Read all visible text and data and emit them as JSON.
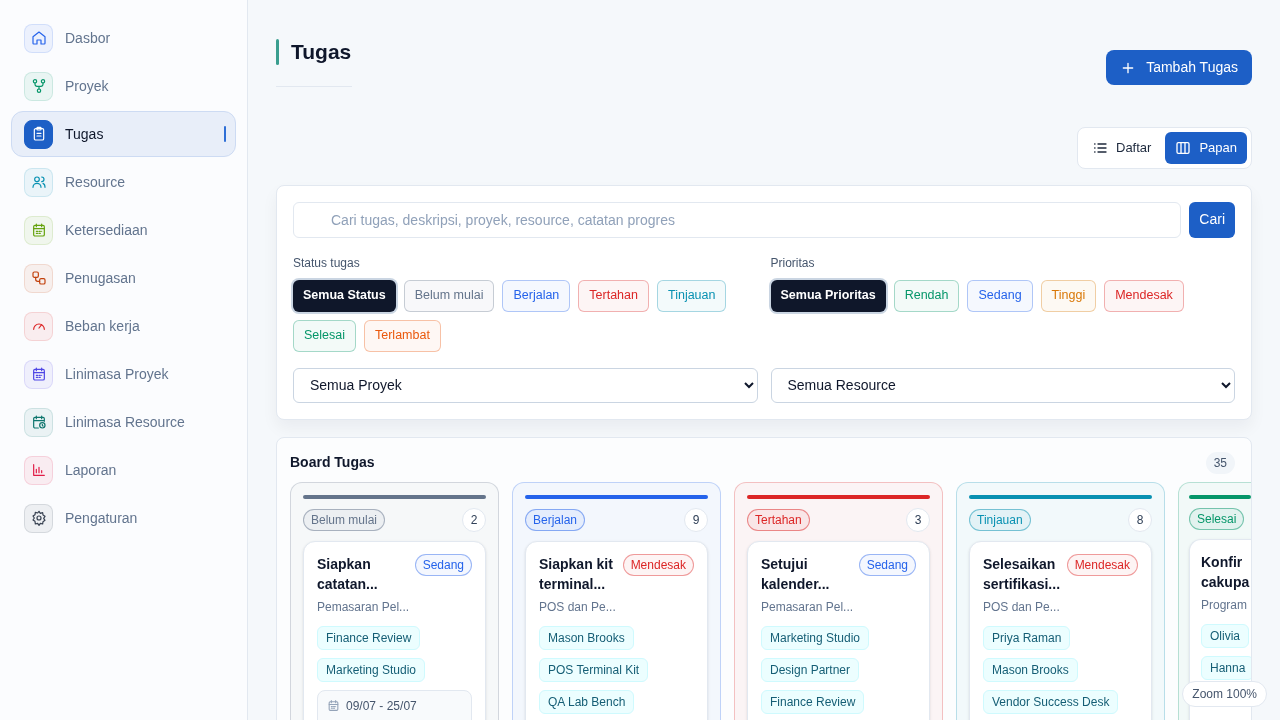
{
  "sidebar": {
    "items": [
      {
        "label": "Dasbor",
        "selected": false
      },
      {
        "label": "Proyek",
        "selected": false
      },
      {
        "label": "Tugas",
        "selected": true
      },
      {
        "label": "Resource",
        "selected": false
      },
      {
        "label": "Ketersediaan",
        "selected": false
      },
      {
        "label": "Penugasan",
        "selected": false
      },
      {
        "label": "Beban kerja",
        "selected": false
      },
      {
        "label": "Linimasa Proyek",
        "selected": false
      },
      {
        "label": "Linimasa Resource",
        "selected": false
      },
      {
        "label": "Laporan",
        "selected": false
      },
      {
        "label": "Pengaturan",
        "selected": false
      }
    ]
  },
  "header": {
    "title": "Tugas",
    "add_button": "Tambah Tugas"
  },
  "view_toggle": [
    {
      "label": "Daftar",
      "selected": false
    },
    {
      "label": "Papan",
      "selected": true
    }
  ],
  "filters": {
    "search": {
      "placeholder": "Cari tugas, deskripsi, proyek, resource, catatan progres"
    },
    "search_button": "Cari",
    "status": {
      "label": "Status tugas",
      "chips": [
        {
          "label": "Semua Status",
          "color": "#0f172a",
          "selected": true
        },
        {
          "label": "Belum mulai",
          "color": "#64748b",
          "selected": false
        },
        {
          "label": "Berjalan",
          "color": "#2563eb",
          "selected": false
        },
        {
          "label": "Tertahan",
          "color": "#dc2626",
          "selected": false
        },
        {
          "label": "Tinjauan",
          "color": "#0891b2",
          "selected": false
        },
        {
          "label": "Selesai",
          "color": "#059669",
          "selected": false
        },
        {
          "label": "Terlambat",
          "color": "#ea580c",
          "selected": false
        }
      ]
    },
    "priority": {
      "label": "Prioritas",
      "chips": [
        {
          "label": "Semua Prioritas",
          "color": "#0f172a",
          "selected": true
        },
        {
          "label": "Rendah",
          "color": "#059669",
          "selected": false
        },
        {
          "label": "Sedang",
          "color": "#2563eb",
          "selected": false
        },
        {
          "label": "Tinggi",
          "color": "#d97706",
          "selected": false
        },
        {
          "label": "Mendesak",
          "color": "#dc2626",
          "selected": false
        }
      ]
    },
    "selects": [
      "Semua Proyek",
      "Semua Resource"
    ]
  },
  "board": {
    "title": "Board Tugas",
    "count": "35",
    "columns": [
      {
        "status": "Belum mulai",
        "count": "2",
        "color": "#64748b",
        "cards": [
          {
            "title_lines": [
              "Siapkan",
              "catatan..."
            ],
            "priority": "Sedang",
            "color": "#2563eb",
            "project": "Pemasaran Pel...",
            "tags": [
              "Finance Review",
              "Marketing Studio"
            ],
            "date": "09/07 - 25/07"
          }
        ]
      },
      {
        "status": "Berjalan",
        "count": "9",
        "color": "#2563eb",
        "cards": [
          {
            "title_lines": [
              "Siapkan kit",
              "terminal..."
            ],
            "priority": "Mendesak",
            "color": "#dc2626",
            "project": "POS dan Pe...",
            "tags": [
              "Mason Brooks",
              "POS Terminal Kit",
              "QA Lab Bench"
            ]
          }
        ]
      },
      {
        "status": "Tertahan",
        "count": "3",
        "color": "#dc2626",
        "cards": [
          {
            "title_lines": [
              "Setujui",
              "kalender..."
            ],
            "priority": "Sedang",
            "color": "#2563eb",
            "project": "Pemasaran Pel...",
            "tags": [
              "Marketing Studio",
              "Design Partner",
              "Finance Review"
            ]
          }
        ]
      },
      {
        "status": "Tinjauan",
        "count": "8",
        "color": "#0891b2",
        "cards": [
          {
            "title_lines": [
              "Selesaikan",
              "sertifikasi..."
            ],
            "priority": "Mendesak",
            "color": "#dc2626",
            "project": "POS dan Pe...",
            "tags": [
              "Priya Raman",
              "Mason Brooks",
              "Vendor Success Desk"
            ]
          }
        ]
      },
      {
        "status": "Selesai",
        "color": "#059669",
        "cards": [
          {
            "title_lines": [
              "Konfir",
              "cakupa"
            ],
            "project": "Program",
            "tags": [
              "Olivia",
              "Hanna"
            ]
          }
        ]
      }
    ]
  },
  "zoom_badge": "Zoom 100%"
}
